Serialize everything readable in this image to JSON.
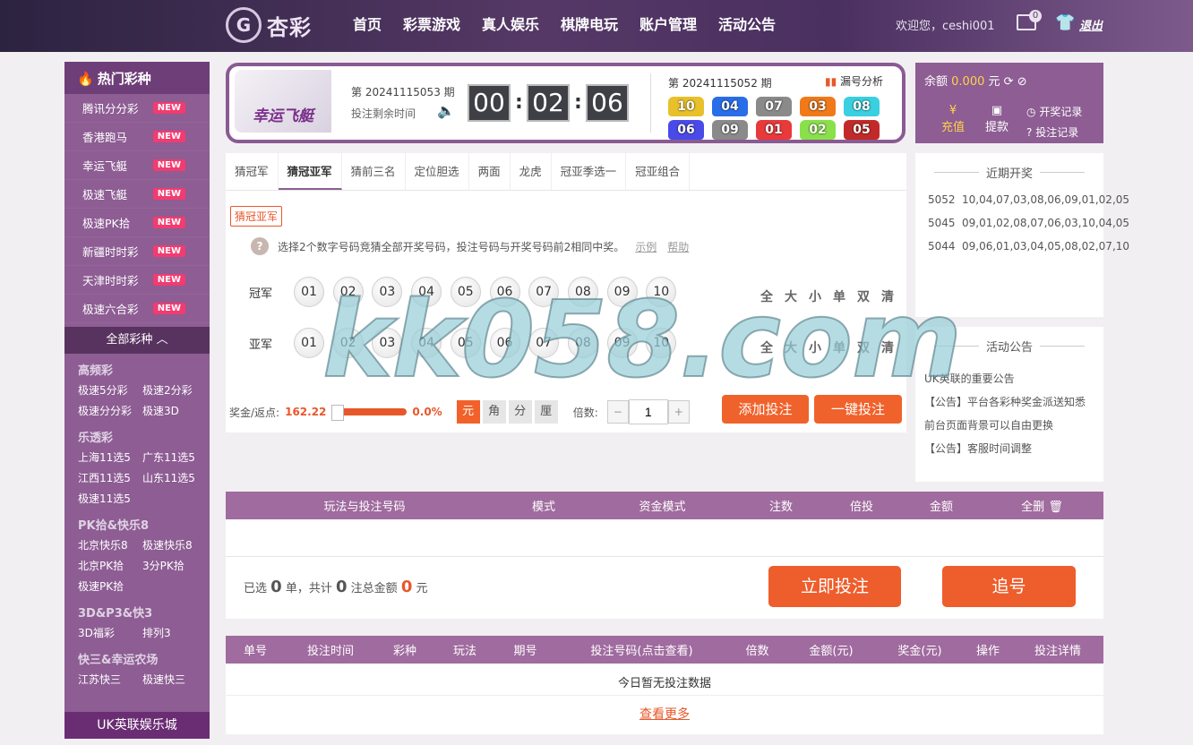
{
  "header": {
    "logo_mark": "G",
    "logo_text": "杏彩",
    "nav": [
      "首页",
      "彩票游戏",
      "真人娱乐",
      "棋牌电玩",
      "账户管理",
      "活动公告"
    ],
    "welcome": "欢迎您，ceshi001",
    "mail_count": "0",
    "logout": "退出"
  },
  "sidebar": {
    "hot_title": "热门彩种",
    "hot_items": [
      {
        "label": "腾讯分分彩",
        "badge": "NEW"
      },
      {
        "label": "香港跑马",
        "badge": "NEW"
      },
      {
        "label": "幸运飞艇",
        "badge": "NEW"
      },
      {
        "label": "极速飞艇",
        "badge": "NEW"
      },
      {
        "label": "极速PK拾",
        "badge": "NEW"
      },
      {
        "label": "新疆时时彩",
        "badge": "NEW"
      },
      {
        "label": "天津时时彩",
        "badge": "NEW"
      },
      {
        "label": "极速六合彩",
        "badge": "NEW"
      }
    ],
    "all_label": "全部彩种",
    "groups": [
      {
        "title": "高频彩",
        "items": [
          "极速5分彩",
          "极速2分彩",
          "极速分分彩",
          "极速3D"
        ]
      },
      {
        "title": "乐透彩",
        "items": [
          "上海11选5",
          "广东11选5",
          "江西11选5",
          "山东11选5",
          "极速11选5"
        ]
      },
      {
        "title": "PK拾&快乐8",
        "items": [
          "北京快乐8",
          "极速快乐8",
          "北京PK拾",
          "3分PK拾",
          "极速PK拾"
        ]
      },
      {
        "title": "3D&P3&快3",
        "items": [
          "3D福彩",
          "排列3"
        ]
      },
      {
        "title": "快三&幸运农场",
        "items": [
          "江苏快三",
          "极速快三"
        ]
      }
    ],
    "footer": "UK英联娱乐城"
  },
  "game": {
    "name": "幸运飞艇",
    "issue_prefix": "第",
    "current_issue": "20241115053",
    "issue_suffix": "期",
    "countdown_label": "投注剩余时间",
    "countdown": [
      "00",
      "02",
      "06"
    ],
    "last_issue": "20241115052",
    "analysis": "漏号分析",
    "last_result": [
      "10",
      "04",
      "07",
      "03",
      "08",
      "06",
      "09",
      "01",
      "02",
      "05"
    ],
    "car_colors": [
      "#e8c02a",
      "#2a6de8",
      "#8a8a8a",
      "#f07a1a",
      "#3ad0e0",
      "#4a4ae8",
      "#8a8a8a",
      "#e83a3a",
      "#8ae04a",
      "#c22a2a"
    ]
  },
  "account": {
    "balance_label": "余额",
    "balance": "0.000",
    "currency": "元",
    "deposit": "充值",
    "withdraw": "提款",
    "draw_record": "开奖记录",
    "bet_record": "投注记录"
  },
  "tabs": [
    "猜冠军",
    "猜冠亚军",
    "猜前三名",
    "定位胆选",
    "两面",
    "龙虎",
    "冠亚季选一",
    "冠亚组合"
  ],
  "active_tab": "猜冠亚军",
  "play": {
    "tag": "猜冠亚军",
    "help": "选择2个数字号码竞猜全部开奖号码，投注号码与开奖号码前2相同中奖。",
    "example": "示例",
    "help_link": "帮助",
    "rows": [
      "冠军",
      "亚军"
    ],
    "balls": [
      "01",
      "02",
      "03",
      "04",
      "05",
      "06",
      "07",
      "08",
      "09",
      "10"
    ],
    "quick": [
      "全",
      "大",
      "小",
      "单",
      "双",
      "清"
    ],
    "odds_label": "奖金/返点:",
    "odds": "162.22",
    "rebate": "0.0%",
    "units": [
      "元",
      "角",
      "分",
      "厘"
    ],
    "multiplier_label": "倍数:",
    "multiplier": "1",
    "add_bet": "添加投注",
    "quick_bet": "一键投注"
  },
  "recent": {
    "title": "近期开奖",
    "draws": [
      {
        "no": "5052",
        "nums": "10,04,07,03,08,06,09,01,02,05"
      },
      {
        "no": "5045",
        "nums": "09,01,02,08,07,06,03,10,04,05"
      },
      {
        "no": "5044",
        "nums": "09,06,01,03,04,05,08,02,07,10"
      }
    ]
  },
  "notices": {
    "title": "活动公告",
    "items": [
      "UK英联的重要公告",
      "【公告】平台各彩种奖金派送知悉",
      "前台页面背景可以自由更换",
      "【公告】客服时间调整"
    ]
  },
  "bet_table": {
    "headers": [
      "玩法与投注号码",
      "模式",
      "资金模式",
      "注数",
      "倍投",
      "金额",
      "全删"
    ],
    "summary": {
      "pre": "已选",
      "count": "0",
      "mid1": "单，共计",
      "bets": "0",
      "mid2": "注总金额",
      "amount": "0",
      "post": "元"
    },
    "submit": "立即投注",
    "chase": "追号"
  },
  "records": {
    "headers": [
      "单号",
      "投注时间",
      "彩种",
      "玩法",
      "期号",
      "投注号码(点击查看)",
      "倍数",
      "金额(元)",
      "奖金(元)",
      "操作",
      "投注详情"
    ],
    "empty": "今日暂无投注数据",
    "more": "查看更多"
  },
  "watermark": "kk058.com",
  "colors": {
    "accent": "#8d5d93",
    "orange": "#f0622b",
    "badge": "#f23b70"
  }
}
